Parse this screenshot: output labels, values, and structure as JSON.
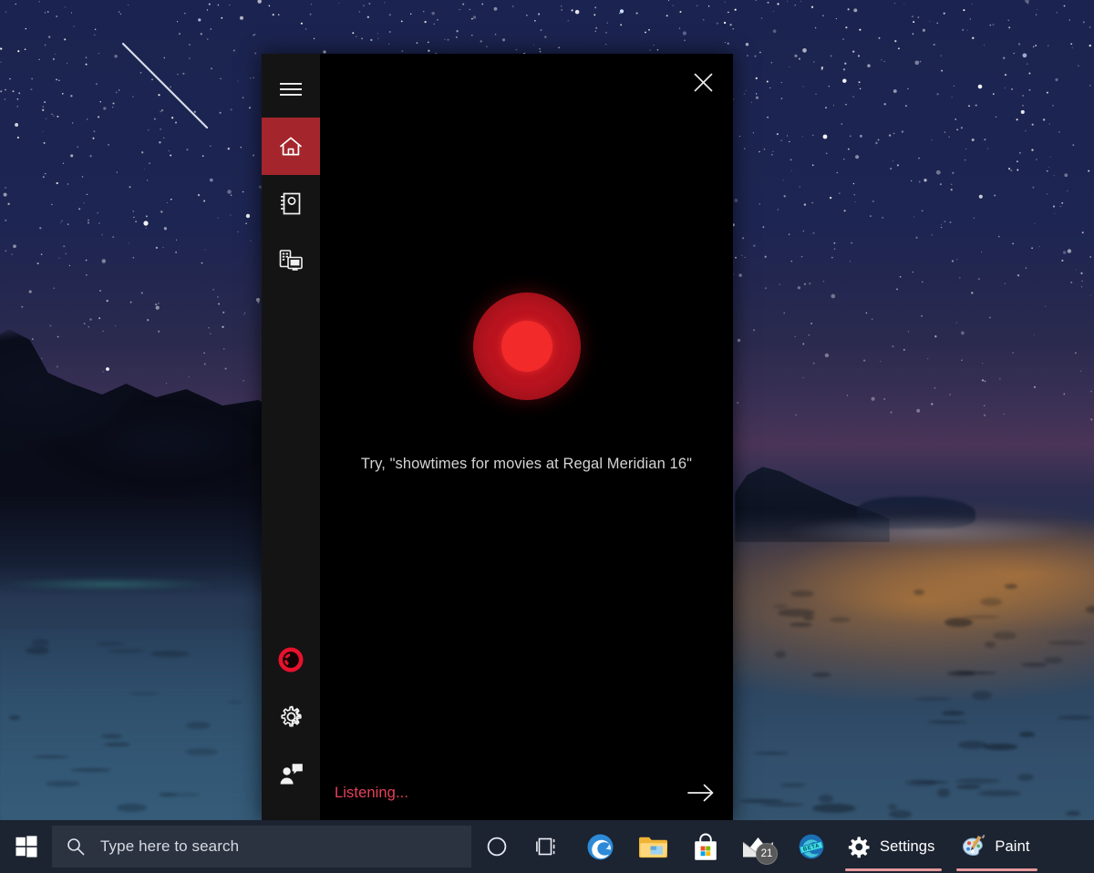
{
  "desktop": {
    "wallpaper_description": "starry night sky over rocky coastline with sunset glow",
    "colors": {
      "taskbar": "#1c2331",
      "search_box": "#2b3341",
      "cortana_accent": "#A4262C",
      "mic_red": "#f32a2a",
      "listening_red": "#e8415a",
      "window_indicator": "#e79a9c"
    }
  },
  "cortana": {
    "sidebar": {
      "items": [
        {
          "name": "hamburger",
          "icon": "hamburger-menu-icon",
          "label": "Menu",
          "active": false
        },
        {
          "name": "home",
          "icon": "home-icon",
          "label": "Home",
          "active": true
        },
        {
          "name": "notebook",
          "icon": "notebook-icon",
          "label": "Notebook",
          "active": false
        },
        {
          "name": "devices",
          "icon": "devices-icon",
          "label": "Devices",
          "active": false
        },
        {
          "name": "cortana-logo",
          "icon": "cortana-logo-icon",
          "label": "Cortana",
          "active": false
        },
        {
          "name": "settings",
          "icon": "gear-icon",
          "label": "Settings",
          "active": false
        },
        {
          "name": "feedback",
          "icon": "feedback-person-icon",
          "label": "Feedback",
          "active": false
        }
      ]
    },
    "close_label": "Close",
    "mic": {
      "state": "listening",
      "icon": "microphone-record-icon"
    },
    "hint": "Try, \"showtimes for movies at Regal Meridian 16\"",
    "status": "Listening...",
    "submit_label": "Submit"
  },
  "taskbar": {
    "start": {
      "label": "Start",
      "icon": "windows-logo-icon"
    },
    "search": {
      "placeholder": "Type here to search",
      "value": "",
      "icon": "search-icon"
    },
    "cortana_button": {
      "label": "Cortana",
      "icon": "cortana-circle-icon"
    },
    "task_view": {
      "label": "Task View",
      "icon": "task-view-icon"
    },
    "items": [
      {
        "name": "edge",
        "label": "Microsoft Edge",
        "icon": "edge-icon",
        "open": false,
        "badge": ""
      },
      {
        "name": "file-explorer",
        "label": "File Explorer",
        "icon": "folder-icon",
        "open": false,
        "badge": ""
      },
      {
        "name": "microsoft-store",
        "label": "Microsoft Store",
        "icon": "store-bag-icon",
        "open": false,
        "badge": ""
      },
      {
        "name": "mail",
        "label": "Mail",
        "icon": "mail-envelope-icon",
        "open": false,
        "badge": "21"
      },
      {
        "name": "edge-beta",
        "label": "Microsoft Edge Beta",
        "icon": "edge-beta-icon",
        "open": false,
        "badge": "",
        "ribbon": "BETA"
      }
    ],
    "windows": [
      {
        "name": "settings",
        "label": "Settings",
        "icon": "gear-icon",
        "open": true
      },
      {
        "name": "paint",
        "label": "Paint",
        "icon": "paint-palette-icon",
        "open": true
      }
    ]
  }
}
